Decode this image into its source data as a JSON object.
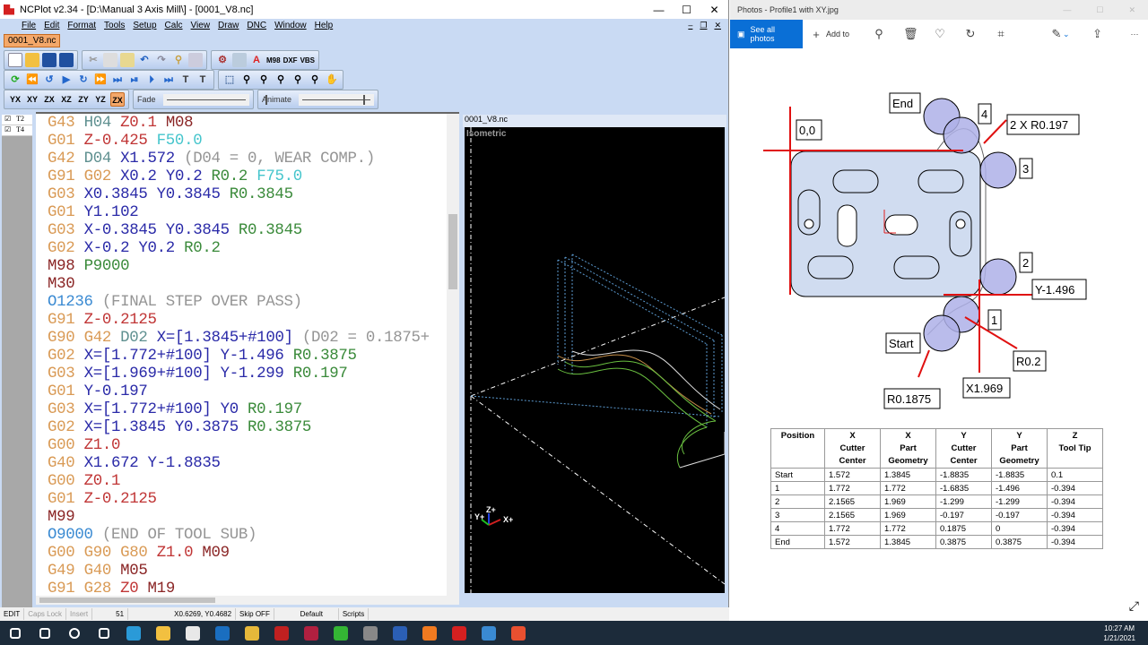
{
  "ncplot": {
    "title": "NCPlot v2.34 - [D:\\Manual 3 Axis Mill\\] - [0001_V8.nc]",
    "menu": [
      "File",
      "Edit",
      "Format",
      "Tools",
      "Setup",
      "Calc",
      "View",
      "Draw",
      "DNC",
      "Window",
      "Help"
    ],
    "file_tab": "0001_V8.nc",
    "toolbar_labels": {
      "m98": "M98",
      "dxf": "DXF",
      "vbs": "VBS",
      "fade": "Fade",
      "animate": "Animate"
    },
    "fade_value": 1.0,
    "animate_value": 0.62,
    "tools": [
      {
        "label": "T2",
        "checked": true
      },
      {
        "label": "T4",
        "checked": true
      }
    ],
    "code": [
      [
        [
          "g",
          "G43"
        ],
        [
          "d",
          "H04"
        ],
        [
          "z",
          "Z0.1"
        ],
        [
          "m",
          "M08"
        ]
      ],
      [
        [
          "g",
          "G01"
        ],
        [
          "z",
          "Z-0.425"
        ],
        [
          "f",
          "F50.0"
        ]
      ],
      [
        [
          "g",
          "G42"
        ],
        [
          "d",
          "D04"
        ],
        [
          "xy",
          "X1.572"
        ],
        [
          "c",
          "(D04 = 0, WEAR COMP.)"
        ]
      ],
      [
        [
          "g",
          "G91"
        ],
        [
          "g",
          "G02"
        ],
        [
          "xy",
          "X0.2"
        ],
        [
          "xy",
          "Y0.2"
        ],
        [
          "r",
          "R0.2"
        ],
        [
          "f",
          "F75.0"
        ]
      ],
      [
        [
          "g",
          "G03"
        ],
        [
          "xy",
          "X0.3845"
        ],
        [
          "xy",
          "Y0.3845"
        ],
        [
          "r",
          "R0.3845"
        ]
      ],
      [
        [
          "g",
          "G01"
        ],
        [
          "xy",
          "Y1.102"
        ]
      ],
      [
        [
          "g",
          "G03"
        ],
        [
          "xy",
          "X-0.3845"
        ],
        [
          "xy",
          "Y0.3845"
        ],
        [
          "r",
          "R0.3845"
        ]
      ],
      [
        [
          "g",
          "G02"
        ],
        [
          "xy",
          "X-0.2"
        ],
        [
          "xy",
          "Y0.2"
        ],
        [
          "r",
          "R0.2"
        ]
      ],
      [
        [
          "m",
          "M98"
        ],
        [
          "p",
          "P9000"
        ]
      ],
      [
        [
          "m",
          "M30"
        ]
      ],
      [
        [
          "o",
          "O1236"
        ],
        [
          "c",
          "(FINAL STEP OVER PASS)"
        ]
      ],
      [
        [
          "g",
          "G91"
        ],
        [
          "z",
          "Z-0.2125"
        ]
      ],
      [
        [
          "g",
          "G90"
        ],
        [
          "g",
          "G42"
        ],
        [
          "d",
          "D02"
        ],
        [
          "xy",
          "X=[1.3845+#100]"
        ],
        [
          "c",
          "(D02 = 0.1875+"
        ]
      ],
      [
        [
          "g",
          "G02"
        ],
        [
          "xy",
          "X=[1.772+#100]"
        ],
        [
          "xy",
          "Y-1.496"
        ],
        [
          "r",
          "R0.3875"
        ]
      ],
      [
        [
          "g",
          "G03"
        ],
        [
          "xy",
          "X=[1.969+#100]"
        ],
        [
          "xy",
          "Y-1.299"
        ],
        [
          "r",
          "R0.197"
        ]
      ],
      [
        [
          "g",
          "G01"
        ],
        [
          "xy",
          "Y-0.197"
        ]
      ],
      [
        [
          "g",
          "G03"
        ],
        [
          "xy",
          "X=[1.772+#100]"
        ],
        [
          "xy",
          "Y0"
        ],
        [
          "r",
          "R0.197"
        ]
      ],
      [
        [
          "g",
          "G02"
        ],
        [
          "xy",
          "X=[1.3845 Y0.3875"
        ],
        [
          "r",
          "R0.3875"
        ]
      ],
      [
        [
          "g",
          "G00"
        ],
        [
          "z",
          "Z1.0"
        ]
      ],
      [
        [
          "g",
          "G40"
        ],
        [
          "xy",
          "X1.672"
        ],
        [
          "xy",
          "Y-1.8835"
        ]
      ],
      [
        [
          "g",
          "G00"
        ],
        [
          "z",
          "Z0.1"
        ]
      ],
      [
        [
          "g",
          "G01"
        ],
        [
          "z",
          "Z-0.2125"
        ]
      ],
      [
        [
          "m",
          "M99"
        ]
      ],
      [
        [
          "o",
          "O9000"
        ],
        [
          "c",
          "(END OF TOOL SUB)"
        ]
      ],
      [
        [
          "g",
          "G00"
        ],
        [
          "g",
          "G90"
        ],
        [
          "g",
          "G80"
        ],
        [
          "z",
          "Z1.0"
        ],
        [
          "m",
          "M09"
        ]
      ],
      [
        [
          "g",
          "G49"
        ],
        [
          "g",
          "G40"
        ],
        [
          "m",
          "M05"
        ]
      ],
      [
        [
          "g",
          "G91"
        ],
        [
          "g",
          "G28"
        ],
        [
          "z",
          "Z0"
        ],
        [
          "m",
          "M19"
        ]
      ]
    ],
    "view": {
      "title": "0001_V8.nc",
      "mode": "Isometric",
      "axis_z": "Z+",
      "axis_y": "Y+",
      "axis_x": "X+"
    },
    "status": {
      "mode": "EDIT",
      "caps": "Caps Lock",
      "insert": "Insert",
      "line": "51",
      "coords": "X0.6269, Y0.4682",
      "skip": "Skip OFF",
      "profile": "Default",
      "scripts": "Scripts"
    }
  },
  "photos": {
    "title": "Photos - Profile1 with XY.jpg",
    "see_all": "See all photos",
    "add_to": "Add to",
    "more": "···",
    "diagram_labels": {
      "origin": "0,0",
      "end": "End",
      "p4": "4",
      "r197": "2 X R0.197",
      "p3": "3",
      "p2": "2",
      "y1496": "Y-1.496",
      "p1": "1",
      "start": "Start",
      "r02": "R0.2",
      "r1875": "R0.1875",
      "x1969": "X1.969"
    },
    "table": {
      "headers": [
        [
          "Position"
        ],
        [
          "X",
          "Cutter",
          "Center"
        ],
        [
          "X",
          "Part",
          "Geometry"
        ],
        [
          "Y",
          "Cutter",
          "Center"
        ],
        [
          "Y",
          "Part",
          "Geometry"
        ],
        [
          "Z",
          "Tool Tip"
        ]
      ],
      "rows": [
        [
          "Start",
          "1.572",
          "1.3845",
          "-1.8835",
          "-1.8835",
          "0.1"
        ],
        [
          "1",
          "1.772",
          "1.772",
          "-1.6835",
          "-1.496",
          "-0.394"
        ],
        [
          "2",
          "2.1565",
          "1.969",
          "-1.299",
          "-1.299",
          "-0.394"
        ],
        [
          "3",
          "2.1565",
          "1.969",
          "-0.197",
          "-0.197",
          "-0.394"
        ],
        [
          "4",
          "1.772",
          "1.772",
          "0.1875",
          "0",
          "-0.394"
        ],
        [
          "End",
          "1.572",
          "1.3845",
          "0.3875",
          "0.3875",
          "-0.394"
        ]
      ]
    }
  },
  "taskbar": {
    "time": "10:27 AM",
    "date": "1/21/2021",
    "apps": [
      "start",
      "search",
      "cortana",
      "task-view",
      "edge",
      "file-explorer",
      "store",
      "outlook",
      "chrome",
      "solidworks",
      "mastercam",
      "camtasia",
      "camera",
      "word",
      "firefox",
      "ncplot",
      "photos",
      "camtasia-recorder"
    ],
    "colors": [
      "#ffffff",
      "#ffffff",
      "#ffffff",
      "#ffffff",
      "#2a9ad8",
      "#f2c040",
      "#e8e8e8",
      "#1a6ec0",
      "#e6b83a",
      "#c02020",
      "#b02040",
      "#34b534",
      "#888888",
      "#2b5fb5",
      "#f07a20",
      "#d42020",
      "#3a8ad2",
      "#e85030"
    ]
  }
}
